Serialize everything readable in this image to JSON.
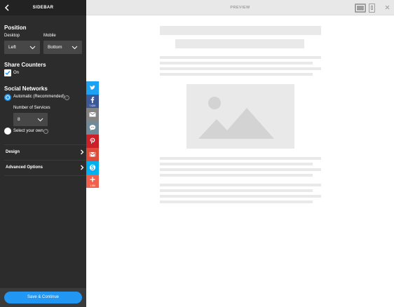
{
  "sidebar": {
    "title": "SIDEBAR",
    "position": {
      "heading": "Position",
      "desktop_label": "Desktop",
      "desktop_value": "Left",
      "mobile_label": "Mobile",
      "mobile_value": "Bottom"
    },
    "share_counters": {
      "heading": "Share Counters",
      "checked": true,
      "label": "On"
    },
    "social_networks": {
      "heading": "Social Networks",
      "automatic_label": "Automatic (Recommended)",
      "number_label": "Number of Services",
      "number_value": "8",
      "select_own_label": "Select your own",
      "selected_option": "automatic"
    },
    "design_label": "Design",
    "advanced_label": "Advanced Options",
    "save_label": "Save & Continue"
  },
  "share_bar": [
    {
      "icon": "twitter-icon",
      "color": "#1da1f2",
      "count": ""
    },
    {
      "icon": "facebook-icon",
      "color": "#3b5998",
      "count": "7.62K"
    },
    {
      "icon": "email-icon",
      "color": "#848484",
      "count": ""
    },
    {
      "icon": "sms-icon",
      "color": "#6f8b9a",
      "count": ""
    },
    {
      "icon": "pinterest-icon",
      "color": "#cb2027",
      "count": ""
    },
    {
      "icon": "gmail-icon",
      "color": "#dd4b39",
      "count": ""
    },
    {
      "icon": "skype-icon",
      "color": "#00aff0",
      "count": ""
    },
    {
      "icon": "more-icon",
      "color": "#f0604c",
      "count": "1.8M"
    }
  ],
  "preview": {
    "title": "PREVIEW",
    "device_selected": "desktop"
  },
  "colors": {
    "sidebar_bg": "#2c2c2c",
    "accent": "#2196f3",
    "placeholder": "#e9e9e9"
  }
}
